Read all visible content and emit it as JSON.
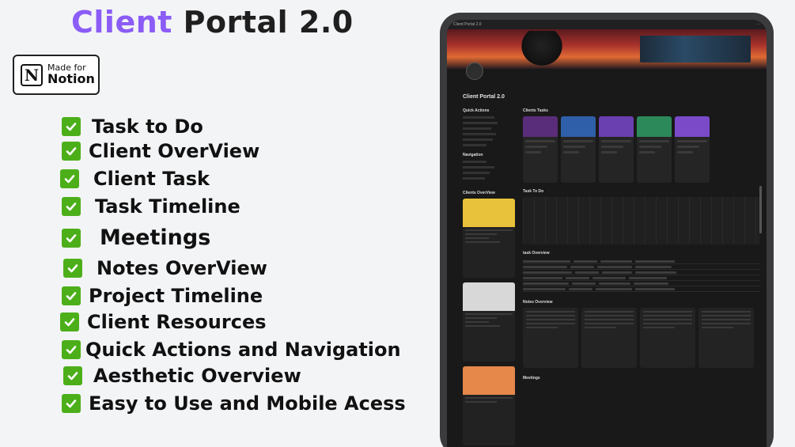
{
  "title": {
    "accent": "Client",
    "rest": "Portal 2.0"
  },
  "badge": {
    "line1": "Made for",
    "line2": "Notion",
    "logo": "N"
  },
  "features": [
    "Task to Do",
    "Client OverView",
    "Client Task",
    "Task Timeline",
    "Meetings",
    "Notes OverView",
    "Project Timeline",
    "Client Resources",
    "Quick Actions and Navigation",
    "Aesthetic Overview",
    "Easy to Use and Mobile Acess"
  ],
  "screen": {
    "topbar_title": "Client Portal 2.0",
    "page_title": "Client Portal 2.0",
    "quick_actions": "Quick Actions",
    "navigation": "Navigation",
    "clients_overview": "Clients OverView",
    "clients_tasks": "Clients Tasks",
    "task_to_do": "Task To Do",
    "task_overview": "task Overview",
    "notes_overview": "Notes Overview",
    "meetings": "Meetings"
  },
  "colors": {
    "accent": "#8b5cf6",
    "check": "#4caf1a",
    "dark": "#191919"
  }
}
